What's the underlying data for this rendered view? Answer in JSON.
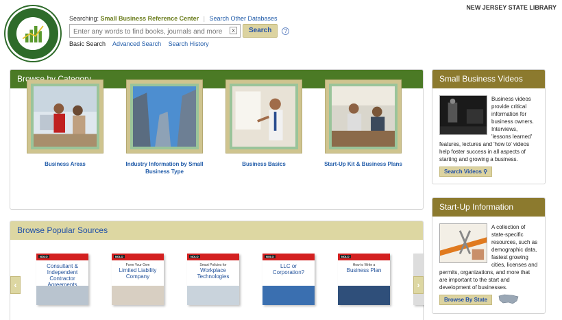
{
  "header": {
    "logo_alt": "Small Business Reference Center",
    "library_name": "NEW JERSEY STATE LIBRARY",
    "searching_label": "Searching:",
    "database": "Small Business Reference Center",
    "other_databases": "Search Other Databases",
    "search_placeholder": "Enter any words to find books, journals and more",
    "search_button": "Search",
    "clear_glyph": "x",
    "help_glyph": "?",
    "links": [
      "Basic Search",
      "Advanced Search",
      "Search History"
    ]
  },
  "browse_category": {
    "title": "Browse by Category",
    "items": [
      {
        "label": "Business Areas"
      },
      {
        "label": "Industry Information by Small Business Type"
      },
      {
        "label": "Business Basics"
      },
      {
        "label": "Start-Up Kit & Business Plans"
      }
    ]
  },
  "popular_sources": {
    "title": "Browse Popular Sources",
    "prev_glyph": "‹",
    "next_glyph": "›",
    "books": [
      {
        "publisher": "NOLO",
        "subtitle": "",
        "title": "Consultant & Independent Contractor Agreements"
      },
      {
        "publisher": "NOLO",
        "subtitle": "Form Your Own",
        "title": "Limited Liability Company"
      },
      {
        "publisher": "NOLO",
        "subtitle": "Smart Policies for",
        "title": "Workplace Technologies"
      },
      {
        "publisher": "NOLO",
        "subtitle": "",
        "title": "LLC or Corporation?"
      },
      {
        "publisher": "NOLO",
        "subtitle": "How to Write a",
        "title": "Business Plan"
      }
    ]
  },
  "videos": {
    "title": "Small Business Videos",
    "text": "Business videos provide critical information for business owners. Interviews, 'lessons learned' features, lectures and 'how to' videos help foster success in all aspects of starting and growing a business.",
    "button": "Search Videos"
  },
  "startup": {
    "title": "Start-Up Information",
    "text": "A collection of state-specific resources, such as demographic data, fastest growing cities, licenses and permits, organizations, and more that are important to the start and development of businesses.",
    "button": "Browse By State"
  },
  "colors": {
    "green": "#4b7a25",
    "olive": "#8c7a2e",
    "link": "#1f5aa8",
    "tan": "#ddd7a2"
  }
}
